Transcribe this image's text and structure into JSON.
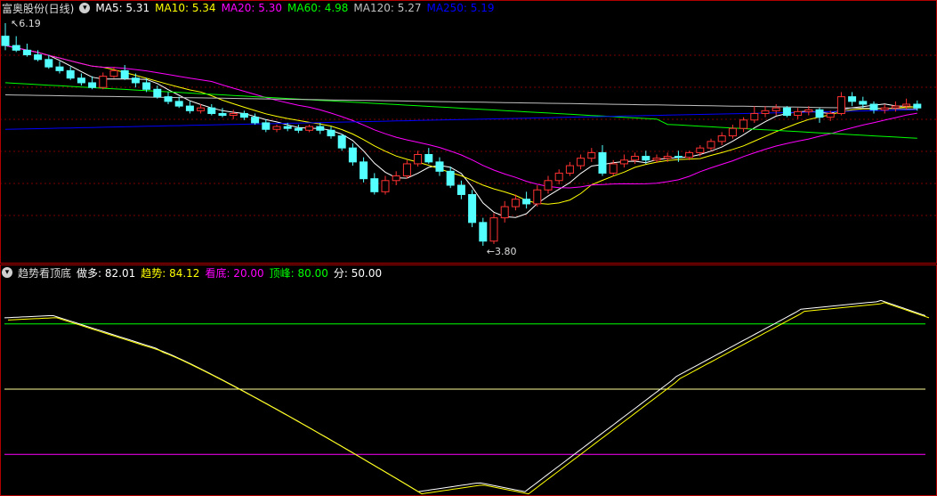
{
  "main": {
    "title": "富奥股份(日线)",
    "ma": [
      {
        "label": "MA5:",
        "value": "5.31",
        "color": "#ffffff"
      },
      {
        "label": "MA10:",
        "value": "5.34",
        "color": "#ffff00"
      },
      {
        "label": "MA20:",
        "value": "5.30",
        "color": "#ff00ff"
      },
      {
        "label": "MA60:",
        "value": "4.98",
        "color": "#00ff00"
      },
      {
        "label": "MA120:",
        "value": "5.27",
        "color": "#c0c0c0"
      },
      {
        "label": "MA250:",
        "value": "5.19",
        "color": "#0000ff"
      }
    ],
    "high_label": "6.19",
    "low_label": "3.80"
  },
  "indicator": {
    "name": "趋势看顶底",
    "items": [
      {
        "label": "做多:",
        "value": "82.01",
        "color": "#ffffff"
      },
      {
        "label": "趋势:",
        "value": "84.12",
        "color": "#ffff00"
      },
      {
        "label": "看底:",
        "value": "20.00",
        "color": "#ff00ff"
      },
      {
        "label": "顶峰:",
        "value": "80.00",
        "color": "#00ff00"
      },
      {
        "label": "分:",
        "value": "50.00",
        "color": "#ffffff"
      }
    ]
  },
  "chart_data": {
    "type": "candlestick",
    "price_range": [
      3.8,
      6.19
    ],
    "candles": [
      [
        6.05,
        6.19,
        5.95,
        5.9
      ],
      [
        5.95,
        6.05,
        5.9,
        5.88
      ],
      [
        5.9,
        5.97,
        5.85,
        5.83
      ],
      [
        5.85,
        5.9,
        5.8,
        5.78
      ],
      [
        5.8,
        5.85,
        5.72,
        5.7
      ],
      [
        5.72,
        5.78,
        5.68,
        5.65
      ],
      [
        5.68,
        5.72,
        5.6,
        5.58
      ],
      [
        5.6,
        5.65,
        5.55,
        5.52
      ],
      [
        5.55,
        5.62,
        5.5,
        5.48
      ],
      [
        5.5,
        5.66,
        5.62,
        5.48
      ],
      [
        5.62,
        5.72,
        5.68,
        5.6
      ],
      [
        5.68,
        5.74,
        5.6,
        5.58
      ],
      [
        5.6,
        5.65,
        5.55,
        5.5
      ],
      [
        5.55,
        5.6,
        5.48,
        5.45
      ],
      [
        5.48,
        5.52,
        5.4,
        5.38
      ],
      [
        5.4,
        5.45,
        5.35,
        5.32
      ],
      [
        5.35,
        5.4,
        5.3,
        5.28
      ],
      [
        5.3,
        5.35,
        5.25,
        5.22
      ],
      [
        5.25,
        5.32,
        5.28,
        5.22
      ],
      [
        5.28,
        5.32,
        5.22,
        5.2
      ],
      [
        5.22,
        5.28,
        5.2,
        5.18
      ],
      [
        5.2,
        5.26,
        5.22,
        5.16
      ],
      [
        5.22,
        5.25,
        5.18,
        5.15
      ],
      [
        5.18,
        5.22,
        5.12,
        5.1
      ],
      [
        5.12,
        5.16,
        5.05,
        5.02
      ],
      [
        5.05,
        5.1,
        5.08,
        5.02
      ],
      [
        5.08,
        5.12,
        5.06,
        5.03
      ],
      [
        5.06,
        5.1,
        5.04,
        5.01
      ],
      [
        5.04,
        5.1,
        5.08,
        5.02
      ],
      [
        5.08,
        5.12,
        5.04,
        5.0
      ],
      [
        5.04,
        5.08,
        4.98,
        4.95
      ],
      [
        4.98,
        5.0,
        4.85,
        4.82
      ],
      [
        4.85,
        4.9,
        4.7,
        4.66
      ],
      [
        4.7,
        4.75,
        4.52,
        4.48
      ],
      [
        4.52,
        4.58,
        4.38,
        4.35
      ],
      [
        4.38,
        4.55,
        4.5,
        4.35
      ],
      [
        4.5,
        4.6,
        4.55,
        4.45
      ],
      [
        4.55,
        4.72,
        4.68,
        4.52
      ],
      [
        4.68,
        4.82,
        4.78,
        4.65
      ],
      [
        4.78,
        4.85,
        4.7,
        4.68
      ],
      [
        4.7,
        4.75,
        4.6,
        4.55
      ],
      [
        4.6,
        4.65,
        4.45,
        4.42
      ],
      [
        4.45,
        4.5,
        4.35,
        4.3
      ],
      [
        4.35,
        4.4,
        4.05,
        4.0
      ],
      [
        4.05,
        4.1,
        3.85,
        3.8
      ],
      [
        3.85,
        4.15,
        4.1,
        3.82
      ],
      [
        4.1,
        4.28,
        4.22,
        4.05
      ],
      [
        4.22,
        4.35,
        4.3,
        4.18
      ],
      [
        4.3,
        4.38,
        4.25,
        4.2
      ],
      [
        4.25,
        4.45,
        4.4,
        4.22
      ],
      [
        4.4,
        4.55,
        4.5,
        4.36
      ],
      [
        4.5,
        4.62,
        4.58,
        4.46
      ],
      [
        4.58,
        4.7,
        4.66,
        4.55
      ],
      [
        4.66,
        4.78,
        4.74,
        4.62
      ],
      [
        4.74,
        4.85,
        4.8,
        4.7
      ],
      [
        4.8,
        4.88,
        4.58,
        4.55
      ],
      [
        4.58,
        4.72,
        4.68,
        4.55
      ],
      [
        4.68,
        4.78,
        4.72,
        4.64
      ],
      [
        4.72,
        4.8,
        4.76,
        4.68
      ],
      [
        4.76,
        4.82,
        4.72,
        4.68
      ],
      [
        4.72,
        4.78,
        4.74,
        4.69
      ],
      [
        4.74,
        4.8,
        4.76,
        4.7
      ],
      [
        4.76,
        4.82,
        4.75,
        4.7
      ],
      [
        4.75,
        4.82,
        4.8,
        4.72
      ],
      [
        4.8,
        4.88,
        4.85,
        4.76
      ],
      [
        4.85,
        4.95,
        4.92,
        4.82
      ],
      [
        4.92,
        5.02,
        4.98,
        4.88
      ],
      [
        4.98,
        5.1,
        5.06,
        4.95
      ],
      [
        5.06,
        5.18,
        5.15,
        5.02
      ],
      [
        5.15,
        5.3,
        5.22,
        5.12
      ],
      [
        5.22,
        5.3,
        5.25,
        5.18
      ],
      [
        5.25,
        5.32,
        5.28,
        5.2
      ],
      [
        5.28,
        5.3,
        5.2,
        5.18
      ],
      [
        5.2,
        5.28,
        5.24,
        5.16
      ],
      [
        5.24,
        5.3,
        5.26,
        5.2
      ],
      [
        5.26,
        5.28,
        5.18,
        5.12
      ],
      [
        5.18,
        5.25,
        5.22,
        5.14
      ],
      [
        5.22,
        5.45,
        5.4,
        5.2
      ],
      [
        5.4,
        5.45,
        5.35,
        5.3
      ],
      [
        5.35,
        5.4,
        5.32,
        5.28
      ],
      [
        5.32,
        5.35,
        5.26,
        5.22
      ],
      [
        5.26,
        5.32,
        5.28,
        5.22
      ],
      [
        5.28,
        5.35,
        5.3,
        5.24
      ],
      [
        5.3,
        5.38,
        5.32,
        5.26
      ],
      [
        5.32,
        5.36,
        5.28,
        5.25
      ]
    ],
    "indicator": {
      "range": [
        0,
        100
      ],
      "lines": {
        "顶峰": 80,
        "分": 50,
        "看底": 20
      }
    }
  }
}
